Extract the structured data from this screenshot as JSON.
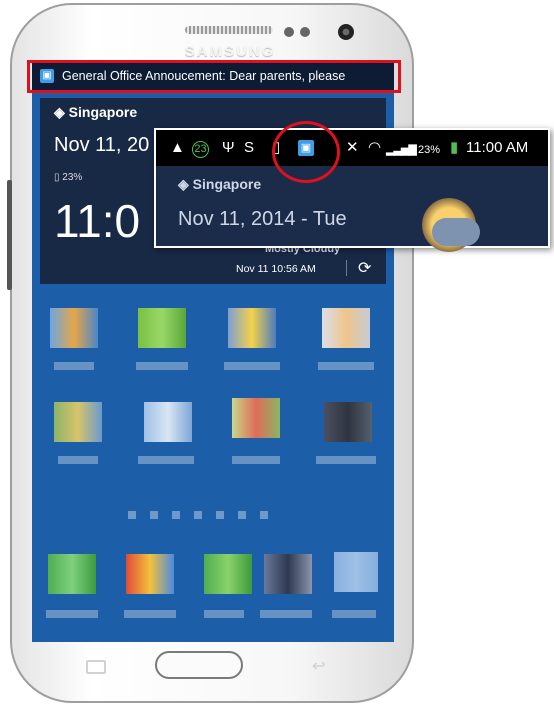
{
  "device": {
    "brand": "SAMSUNG"
  },
  "notification": {
    "text": "General Office Annoucement: Dear parents, please"
  },
  "widget": {
    "city": "Singapore",
    "date": "Nov 11, 20",
    "battery": "23%",
    "time": "11:0",
    "condition": "Mostly Cloudy",
    "updated": "Nov 11  10:56 AM"
  },
  "zoom": {
    "battery": "23%",
    "time": "11:00 AM",
    "badge": "23",
    "city": "Singapore",
    "date": "Nov 11, 2014 - Tue"
  },
  "glyphs": {
    "location": "◈",
    "refresh": "⟳",
    "back": "↩",
    "usb": "Ψ",
    "wifi": "◠",
    "signal": "▂▃▅▇",
    "mute": "✕",
    "battery": "▮",
    "notif": "▣",
    "tablet": "▯"
  },
  "colors": {
    "highlight": "#e0101c",
    "home_bg": "#1c5fa8"
  }
}
